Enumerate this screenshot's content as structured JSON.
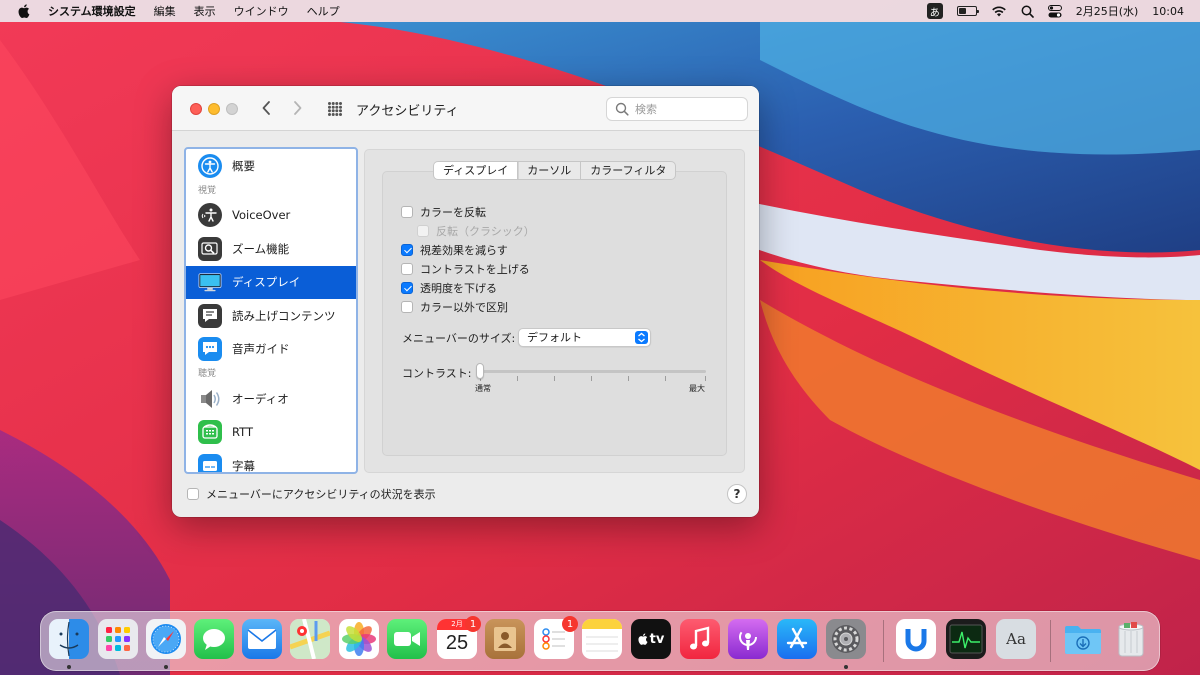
{
  "menubar": {
    "app_name": "システム環境設定",
    "items": [
      "編集",
      "表示",
      "ウインドウ",
      "ヘルプ"
    ],
    "ime": "あ",
    "datetime": "2月25日(水)",
    "time": "10:04"
  },
  "window": {
    "title": "アクセシビリティ",
    "search_placeholder": "検索",
    "sidebar": {
      "items": [
        {
          "label": "概要"
        },
        {
          "header": "視覚"
        },
        {
          "label": "VoiceOver"
        },
        {
          "label": "ズーム機能"
        },
        {
          "label": "ディスプレイ"
        },
        {
          "label": "読み上げコンテンツ"
        },
        {
          "label": "音声ガイド"
        },
        {
          "header": "聴覚"
        },
        {
          "label": "オーディオ"
        },
        {
          "label": "RTT"
        },
        {
          "label": "字幕"
        }
      ],
      "selected": "ディスプレイ"
    },
    "tabs": [
      "ディスプレイ",
      "カーソル",
      "カラーフィルタ"
    ],
    "active_tab": "ディスプレイ",
    "options": [
      {
        "label": "カラーを反転",
        "checked": false,
        "enabled": true
      },
      {
        "label": "反転（クラシック）",
        "checked": false,
        "enabled": false
      },
      {
        "label": "視差効果を減らす",
        "checked": true,
        "enabled": true
      },
      {
        "label": "コントラストを上げる",
        "checked": false,
        "enabled": true
      },
      {
        "label": "透明度を下げる",
        "checked": true,
        "enabled": true
      },
      {
        "label": "カラー以外で区別",
        "checked": false,
        "enabled": true
      }
    ],
    "menubar_size": {
      "label": "メニューバーのサイズ:",
      "value": "デフォルト"
    },
    "contrast": {
      "label": "コントラスト:",
      "min_label": "通常",
      "max_label": "最大",
      "value": 0
    },
    "show_status": {
      "label": "メニューバーにアクセシビリティの状況を表示",
      "checked": false
    },
    "help_label": "?"
  },
  "dock": {
    "calendar": {
      "month": "2月",
      "day": "25"
    },
    "badges": {
      "calendar": "1",
      "reminders": "1"
    },
    "appletv_label": "tv",
    "dictionary_label": "Aa"
  },
  "colors": {
    "accent": "#0a7aff",
    "selection": "#0a5ed7",
    "badge": "#f6362e"
  }
}
